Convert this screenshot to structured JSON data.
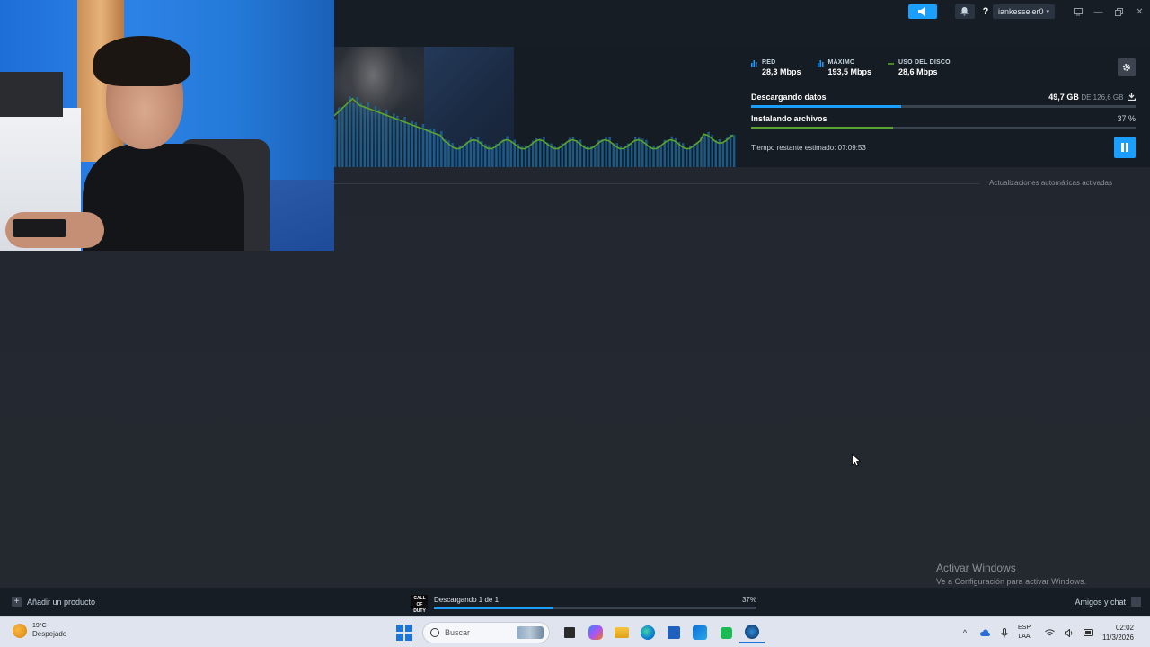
{
  "titlebar": {
    "username": "iankesseler0",
    "help_label": "?",
    "window_controls": [
      "minimize-icon",
      "maximize-icon",
      "close-icon"
    ]
  },
  "download_header": {
    "stats": [
      {
        "label": "RED",
        "value": "28,3 Mbps",
        "color": "#1a9fff"
      },
      {
        "label": "MÁXIMO",
        "value": "193,5 Mbps",
        "color": "#1a9fff"
      },
      {
        "label": "USO DEL DISCO",
        "value": "28,6 Mbps",
        "color": "#5ba32b"
      }
    ],
    "downloading_label": "Descargando datos",
    "downloaded_amount": "49,7 GB",
    "downloaded_of": "DE 126,6 GB",
    "download_fraction": 0.39,
    "installing_label": "Instalando archivos",
    "install_percent_text": "37 %",
    "install_fraction": 0.37,
    "time_remaining": "Tiempo restante estimado: 07:09:53"
  },
  "auto_updates_label": "Actualizaciones automáticas activadas",
  "watermark": {
    "title": "Activar Windows",
    "subtitle": "Ve a Configuración para activar Windows."
  },
  "statusbar": {
    "add_product": "Añadir un producto",
    "game_icon_text": "CALL OF DUTY",
    "download_status": "Descargando 1 de 1",
    "download_percent": "37%",
    "download_fraction": 0.37,
    "friends_chat": "Amigos y chat"
  },
  "taskbar": {
    "weather_temp": "19°C",
    "weather_condition": "Despejado",
    "search_placeholder": "Buscar",
    "apps": [
      "file-explorer-icon",
      "copilot-icon",
      "folder-icon",
      "edge-icon",
      "store-icon",
      "outlook-icon",
      "spotify-icon",
      "steam-icon"
    ],
    "lang_top": "ESP",
    "lang_bottom": "LAA",
    "time": "02:02",
    "date": "11/3/2026"
  },
  "colors": {
    "accent": "#1a9fff",
    "disk_green": "#5ba32b",
    "titlebar_bg": "#171d25"
  }
}
